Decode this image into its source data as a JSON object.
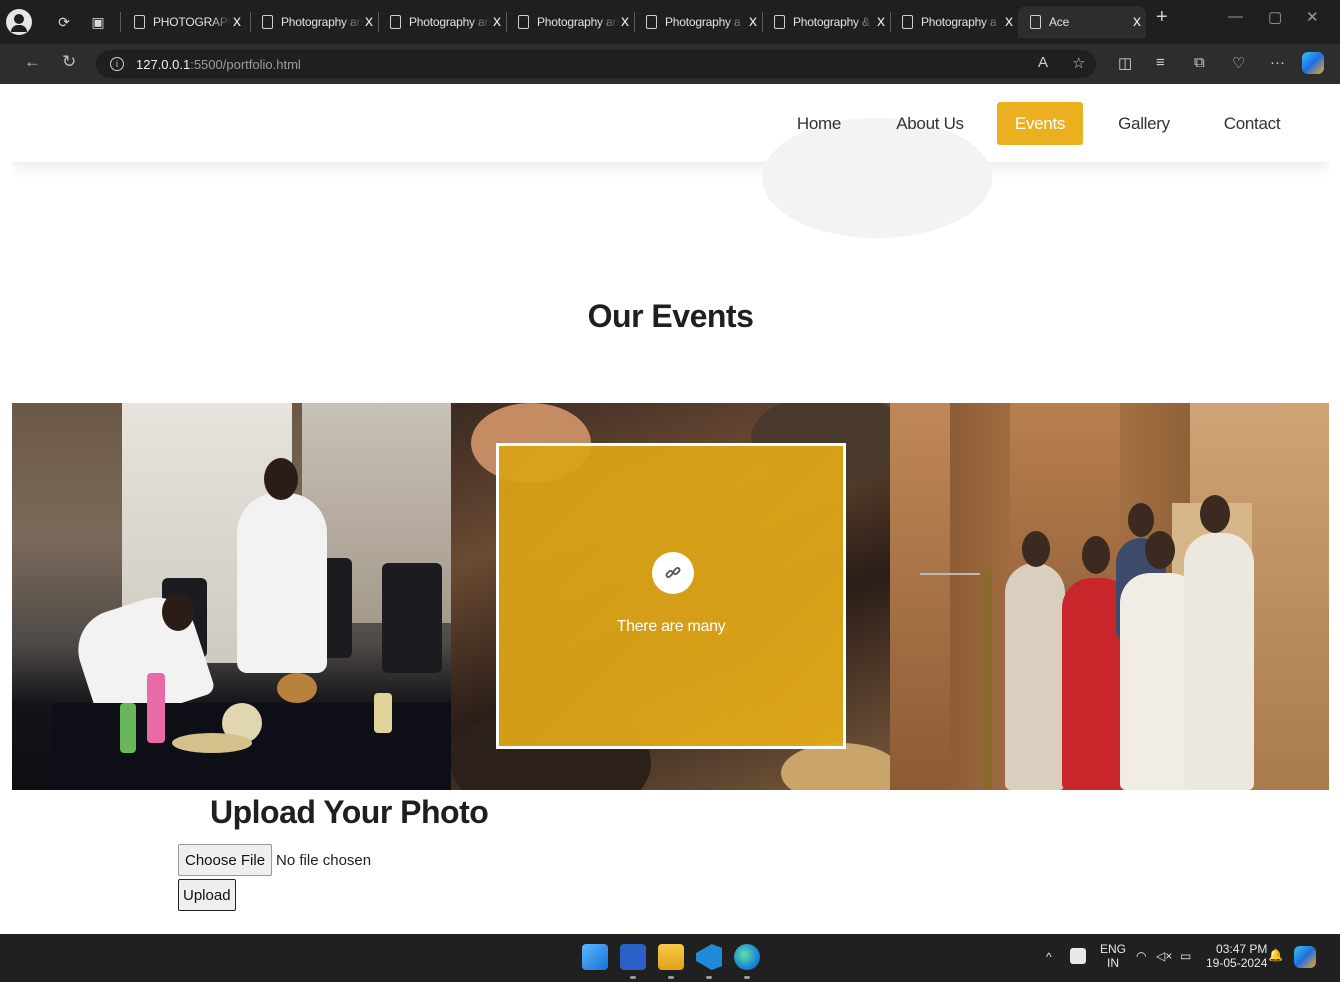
{
  "browser": {
    "tabs": [
      {
        "title": "PHOTOGRAPHY",
        "active": false
      },
      {
        "title": "Photography an",
        "active": false
      },
      {
        "title": "Photography an",
        "active": false
      },
      {
        "title": "Photography an",
        "active": false
      },
      {
        "title": "Photography a",
        "active": false
      },
      {
        "title": "Photography &",
        "active": false
      },
      {
        "title": "Photography a",
        "active": false
      },
      {
        "title": "Ace",
        "active": true
      }
    ],
    "url_host": "127.0.0.1",
    "url_path": ":5500/portfolio.html",
    "new_tab_symbol": "+",
    "close_symbol": "x"
  },
  "site": {
    "nav": [
      {
        "label": "Home",
        "active": false
      },
      {
        "label": "About Us",
        "active": false
      },
      {
        "label": "Events",
        "active": true
      },
      {
        "label": "Gallery",
        "active": false
      },
      {
        "label": "Contact",
        "active": false
      }
    ],
    "accent_color": "#eab01f",
    "events_title": "Our Events",
    "gallery": {
      "card_caption": "There are many",
      "card_icon": "link-icon"
    },
    "upload": {
      "title": "Upload Your Photo",
      "choose_file_label": "Choose File",
      "file_status": "No file chosen",
      "upload_label": "Upload"
    }
  },
  "taskbar": {
    "apps": [
      "windows-start-icon",
      "word-icon",
      "file-explorer-icon",
      "vscode-icon",
      "edge-icon"
    ],
    "lang_primary": "ENG",
    "lang_secondary": "IN",
    "time": "03:47 PM",
    "date": "19-05-2024"
  }
}
